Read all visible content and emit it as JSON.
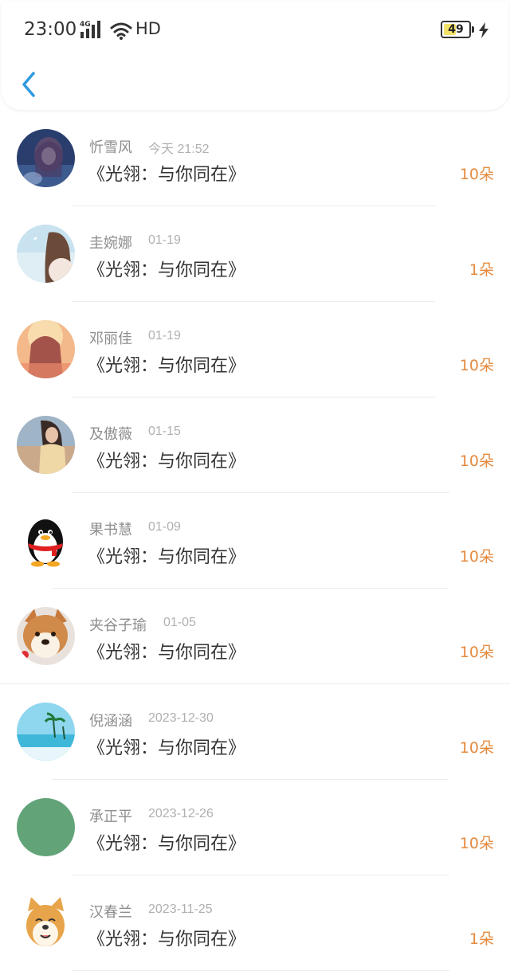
{
  "statusbar": {
    "time": "23:00",
    "network": "4G",
    "hd": "HD",
    "battery": "49",
    "battery_level": 0.49,
    "charging_icon": "lightning-icon"
  },
  "nav": {
    "back_icon": "chevron-left-icon"
  },
  "colors": {
    "accent": "#2f9ae0",
    "count": "#e58a3e",
    "name": "#8e8e8e",
    "time": "#b0b0b0"
  },
  "items": [
    {
      "name": "忻雪风",
      "time": "今天 21:52",
      "title": "《光翎：与你同在》",
      "count": "10朵"
    },
    {
      "name": "圭婉娜",
      "time": "01-19",
      "title": "《光翎：与你同在》",
      "count": "1朵"
    },
    {
      "name": "邓丽佳",
      "time": "01-19",
      "title": "《光翎：与你同在》",
      "count": "10朵"
    },
    {
      "name": "及傲薇",
      "time": "01-15",
      "title": "《光翎：与你同在》",
      "count": "10朵"
    },
    {
      "name": "果书慧",
      "time": "01-09",
      "title": "《光翎：与你同在》",
      "count": "10朵"
    },
    {
      "name": "夹谷子瑜",
      "time": "01-05",
      "title": "《光翎：与你同在》",
      "count": "10朵"
    },
    {
      "name": "倪涵涵",
      "time": "2023-12-30",
      "title": "《光翎：与你同在》",
      "count": "10朵"
    },
    {
      "name": "承正平",
      "time": "2023-12-26",
      "title": "《光翎：与你同在》",
      "count": "10朵"
    },
    {
      "name": "汉春兰",
      "time": "2023-11-25",
      "title": "《光翎：与你同在》",
      "count": "1朵"
    }
  ]
}
